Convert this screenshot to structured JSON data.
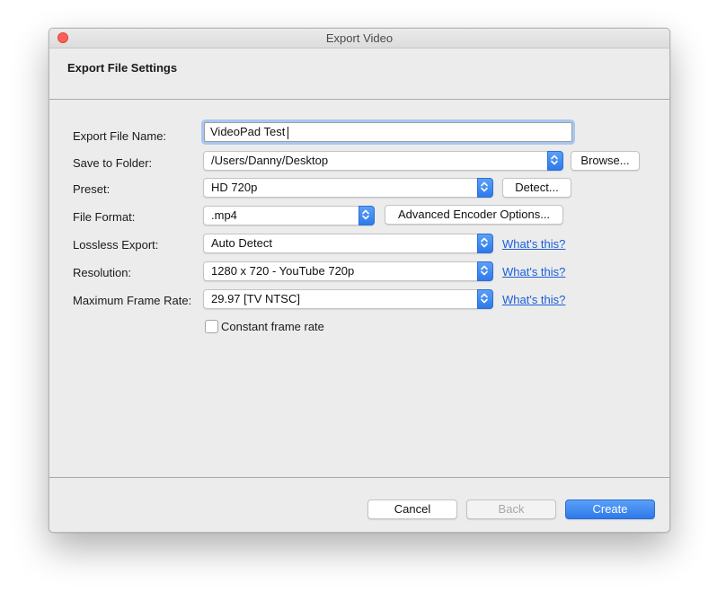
{
  "window": {
    "title": "Export Video"
  },
  "header": {
    "title": "Export File Settings"
  },
  "form": {
    "file_name_label": "Export File Name:",
    "file_name_value": "VideoPad Test",
    "folder_label": "Save to Folder:",
    "folder_value": "/Users/Danny/Desktop",
    "browse_label": "Browse...",
    "preset_label": "Preset:",
    "preset_value": "HD 720p",
    "detect_label": "Detect...",
    "format_label": "File Format:",
    "format_value": ".mp4",
    "advanced_label": "Advanced Encoder Options...",
    "lossless_label": "Lossless Export:",
    "lossless_value": "Auto Detect",
    "resolution_label": "Resolution:",
    "resolution_value": "1280 x 720 - YouTube 720p",
    "framerate_label": "Maximum Frame Rate:",
    "framerate_value": "29.97 [TV NTSC]",
    "whats_this": "What's this?",
    "constant_rate_label": "Constant frame rate",
    "constant_rate_checked": false
  },
  "footer": {
    "cancel_label": "Cancel",
    "back_label": "Back",
    "create_label": "Create"
  },
  "colors": {
    "accent": "#2f79ea",
    "link": "#1a5fd8",
    "close": "#fe5f57"
  }
}
